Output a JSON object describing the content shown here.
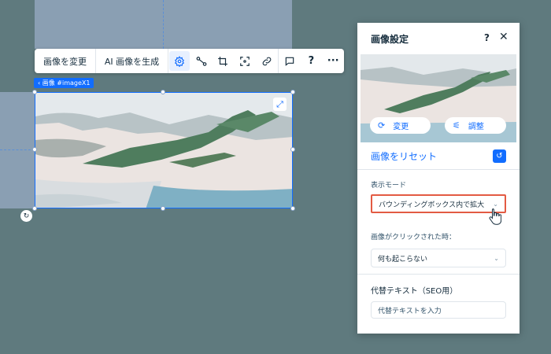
{
  "toolbar": {
    "change_image_label": "画像を変更",
    "ai_generate_label": "AI 画像を生成",
    "icons": [
      "gear-icon",
      "connect-icon",
      "crop-icon",
      "focal-point-icon",
      "link-icon",
      "comment-icon",
      "help-icon",
      "more-icon"
    ],
    "help_glyph": "?",
    "more_glyph": "···"
  },
  "breadcrumb": {
    "label": "‹ 画像 #imageX1"
  },
  "panel": {
    "title": "画像設定",
    "help": "?",
    "close": "✕",
    "change_label": "変更",
    "adjust_label": "調整",
    "reset_label": "画像をリセット",
    "display_mode": {
      "label": "表示モード",
      "value": "バウンディングボックス内で拡大"
    },
    "on_click": {
      "label": "画像がクリックされた時：",
      "value": "何も起こらない"
    },
    "alt_text": {
      "title": "代替テキスト（SEO用）",
      "placeholder": "代替テキストを入力"
    }
  },
  "colors": {
    "accent": "#116dff",
    "highlight": "#e35b43",
    "canvas": "#5f7a7e"
  }
}
